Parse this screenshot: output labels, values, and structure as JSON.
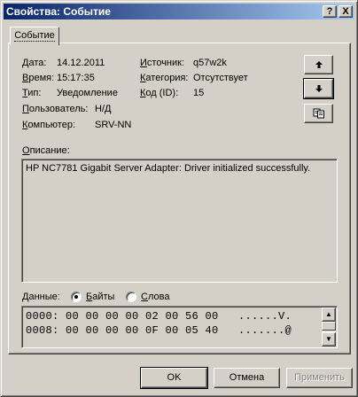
{
  "window": {
    "title": "Свойства: Событие",
    "help_glyph": "?",
    "close_glyph": "X"
  },
  "tabs": [
    {
      "label": "Событие",
      "active": true
    }
  ],
  "event": {
    "date_label": "Дата:",
    "date": "14.12.2011",
    "time_label": "Время:",
    "time": "15:17:35",
    "type_label": "Тип:",
    "type": "Уведомление",
    "user_label": "Пользователь:",
    "user": "Н/Д",
    "computer_label": "Компьютер:",
    "computer": "SRV-NN",
    "source_label": "Источник:",
    "source": "q57w2k",
    "category_label": "Категория:",
    "category": "Отсутствует",
    "id_label": "Код (ID):",
    "id": "15"
  },
  "description": {
    "label": "Описание:",
    "text": "HP NC7781 Gigabit Server Adapter: Driver initialized successfully."
  },
  "data": {
    "label": "Данные:",
    "format_options": [
      {
        "label": "Байты",
        "selected": true
      },
      {
        "label": "Слова",
        "selected": false
      }
    ],
    "lines": [
      "0000: 00 00 00 00 02 00 56 00   ......V.",
      "0008: 00 00 00 00 0F 00 05 40   .......@"
    ]
  },
  "nav_buttons": {
    "up_icon": "arrow-up-icon",
    "down_icon": "arrow-down-icon",
    "copy_icon": "copy-icon"
  },
  "buttons": {
    "ok": "OK",
    "cancel": "Отмена",
    "apply": "Применить"
  },
  "colors": {
    "title_start": "#0a246a",
    "title_end": "#a6caf0",
    "face": "#d4d0c8"
  }
}
